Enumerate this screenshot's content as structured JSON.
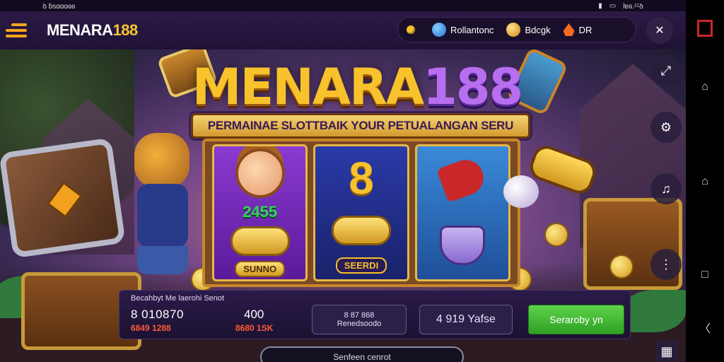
{
  "status_bar": {
    "left_text": "ꝺ ɓsɑɑɑɞɞ",
    "right_text": "lɐɞ.ᶻᶻꝺ"
  },
  "header": {
    "logo_text": "MENARA",
    "logo_number": "188",
    "pill_items": [
      {
        "icon": "coin-icon",
        "label": ""
      },
      {
        "icon": "globe-icon",
        "label": "Rollantonc"
      },
      {
        "icon": "bell-icon",
        "label": "Bdcgk"
      },
      {
        "icon": "flame-icon",
        "label": "DR"
      }
    ],
    "circle_button_icon": "close-icon"
  },
  "game": {
    "title_word": "MENARA",
    "title_number": "188",
    "banner_text": "PERMAINAE SLOTTBAIK YOUR PETUALANGAN SERU",
    "reels": [
      {
        "symbol": "face",
        "value": "2455",
        "label": "SUNNO"
      },
      {
        "symbol": "eight",
        "value": "",
        "label": "SEERDI"
      },
      {
        "symbol": "bottle",
        "value": "",
        "label": ""
      }
    ]
  },
  "info_bar": {
    "title": "Becahbyt Me laerohi Senot",
    "stat_left": "8 010870",
    "stat_right": "400",
    "sub_left": "6849 1288",
    "sub_right": "8680 1SK",
    "box1_line1": "8 87 868",
    "box1_line2": "Renedsoodo",
    "box2_label": "4 919 Yafse",
    "action_button": "Seraroby yn"
  },
  "bottom_pill": "Senfeen cenrot",
  "side_buttons": [
    "share-icon",
    "settings-icon",
    "sound-icon",
    "history-icon",
    "exit-icon"
  ],
  "colors": {
    "accent_gold": "#f7c22b",
    "accent_purple": "#b86ef0",
    "action_green": "#3bb52e",
    "alert_red": "#ff5a3a"
  }
}
